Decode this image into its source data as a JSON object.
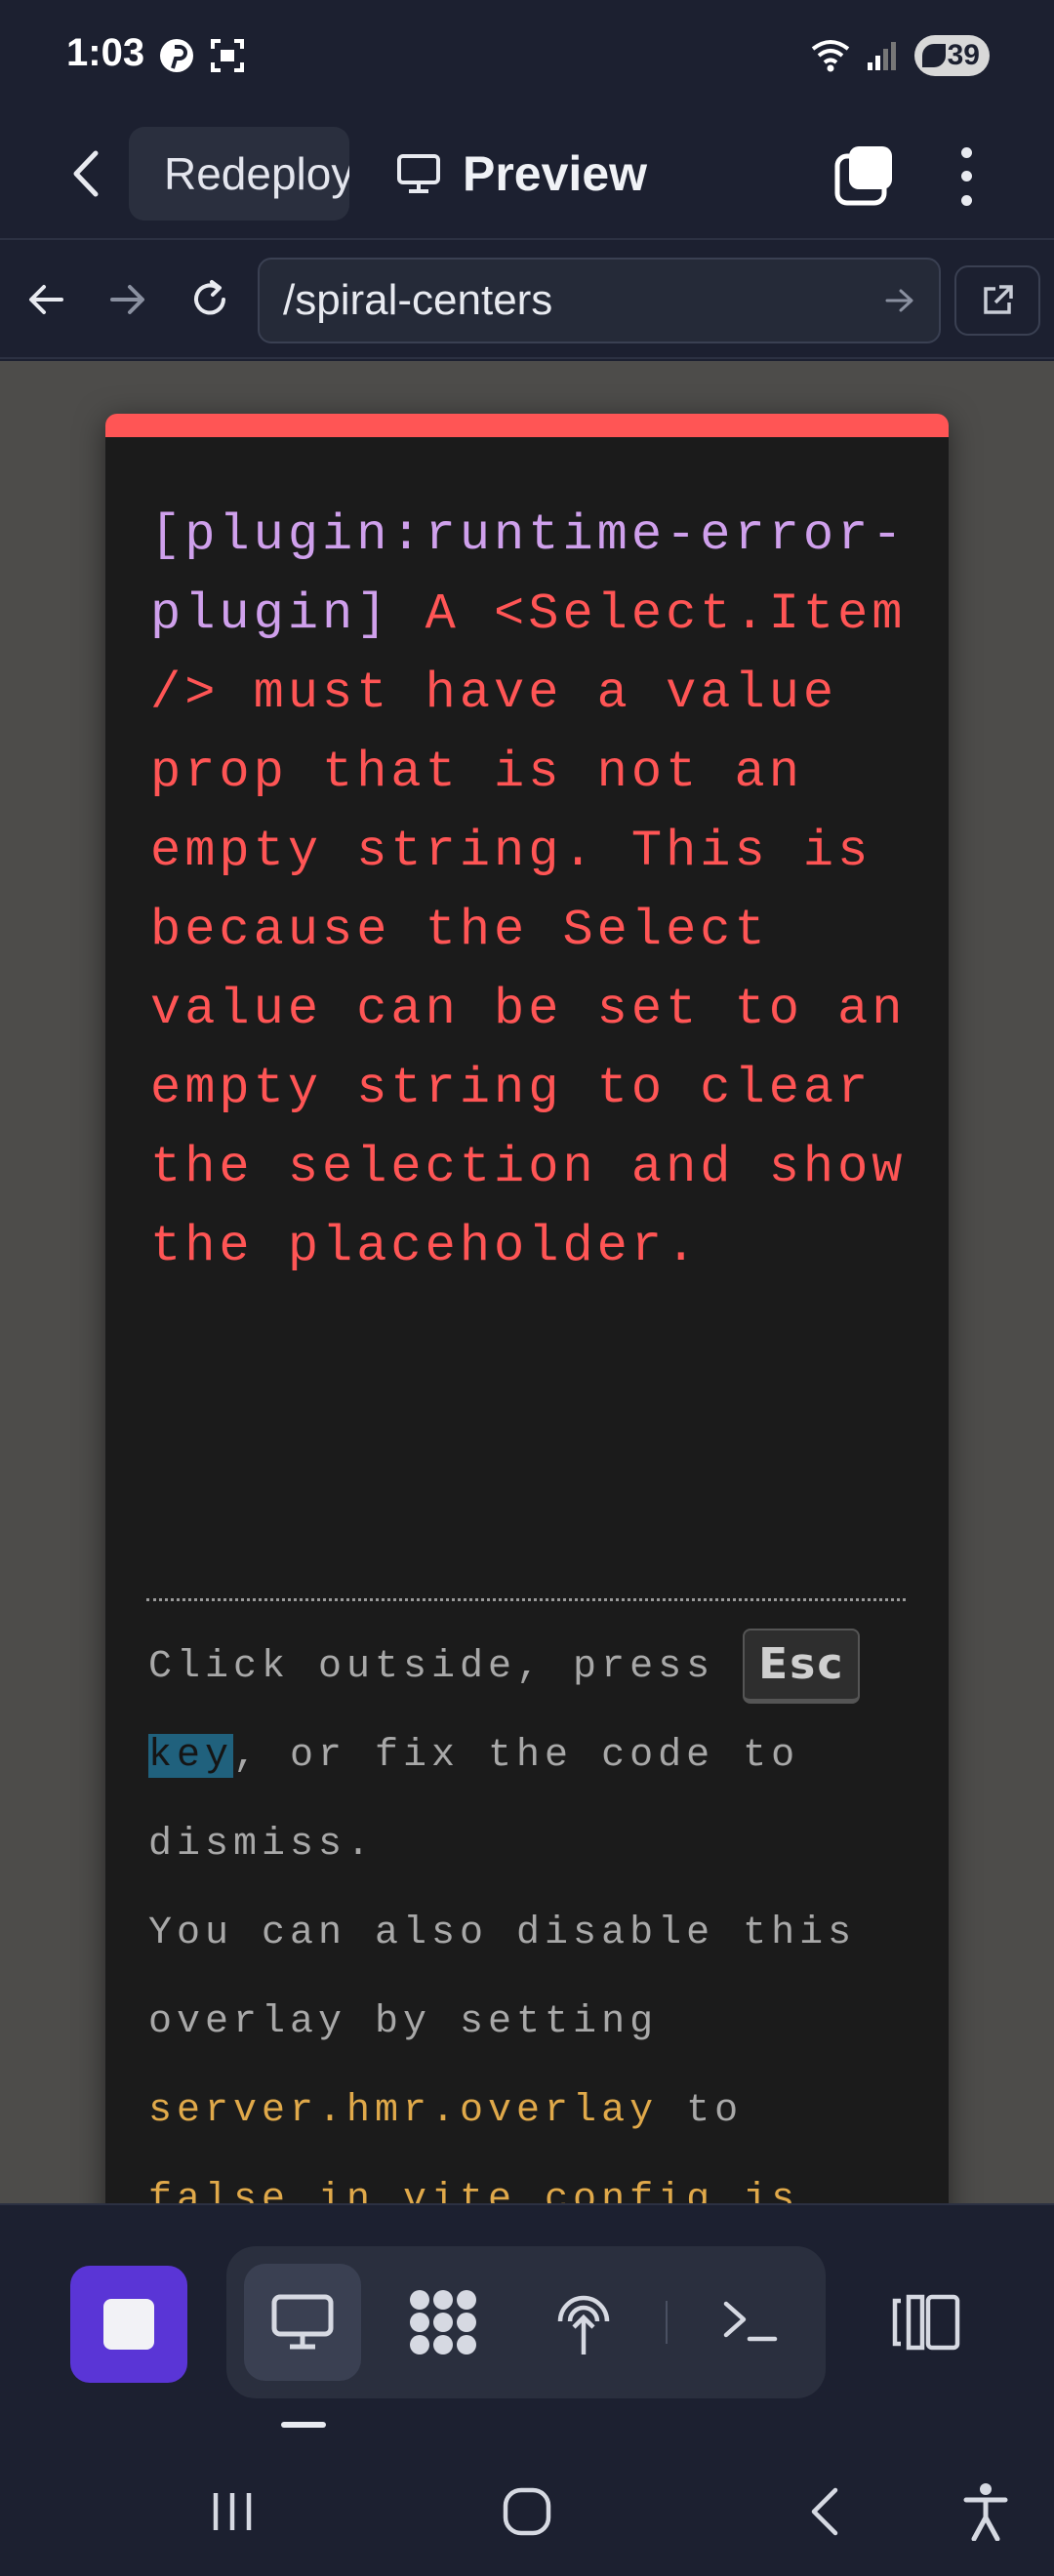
{
  "status_bar": {
    "time": "1:03",
    "battery": "39",
    "icons": [
      "pinterest-icon",
      "screenshot-icon",
      "wifi-icon",
      "signal-icon",
      "battery-icon"
    ]
  },
  "app_bar": {
    "repl_name": "Redeploy",
    "preview_label": "Preview",
    "icons": [
      "back-arrow-icon",
      "repl-logo-icon",
      "monitor-icon",
      "tabs-icon",
      "more-vertical-icon"
    ]
  },
  "url_bar": {
    "url": "/spiral-centers",
    "icons": [
      "nav-back-icon",
      "nav-forward-icon",
      "reload-icon",
      "go-arrow-icon",
      "open-external-icon"
    ]
  },
  "error_overlay": {
    "plugin": "[plugin:runtime-error-plugin]",
    "message": " A <Select.Item /> must have a value prop that is not an empty string. This is because the Select value can be set to an empty string to clear the selection and show the placeholder.",
    "tip_1_before": "Click outside, press ",
    "tip_1_kbd": "Esc",
    "tip_1_key": "key",
    "tip_1_after": ", or fix the code to dismiss.",
    "tip_2_before": "You can also disable this overlay by setting ",
    "tip_2_code": "server.hmr.overlay",
    "tip_2_after": " to",
    "tip_2_cut": "false in vite.config.js"
  },
  "colors": {
    "accent": "#5a35d6",
    "error": "#ff5555",
    "plugin_text": "#cfa0ec",
    "code_text": "#e0a94a",
    "background": "#1c2030"
  },
  "bottom_toolbar": {
    "icons": [
      "stop-icon",
      "webview-icon",
      "workspace-icon",
      "deploy-icon",
      "shell-icon",
      "split-view-icon"
    ]
  },
  "system_nav": {
    "icons": [
      "recents-icon",
      "home-icon",
      "back-icon",
      "accessibility-icon"
    ]
  }
}
